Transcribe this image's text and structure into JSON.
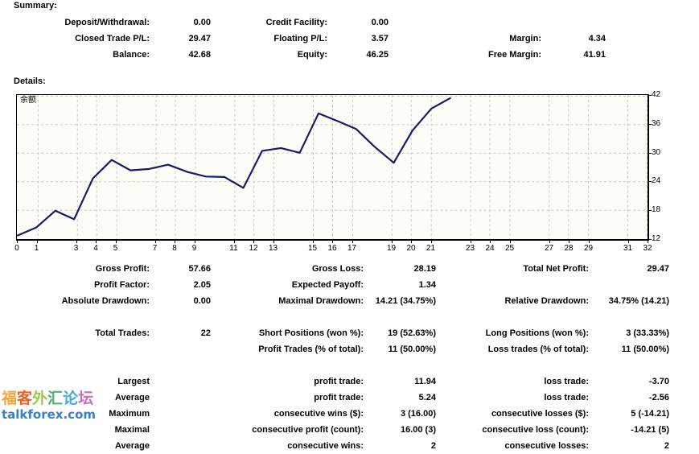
{
  "summary": {
    "title": "Summary:",
    "rows": [
      {
        "l1": "Deposit/Withdrawal:",
        "v1": "0.00",
        "l2": "Credit Facility:",
        "v2": "0.00",
        "l3": "",
        "v3": ""
      },
      {
        "l1": "Closed Trade P/L:",
        "v1": "29.47",
        "l2": "Floating P/L:",
        "v2": "3.57",
        "l3": "Margin:",
        "v3": "4.34"
      },
      {
        "l1": "Balance:",
        "v1": "42.68",
        "l2": "Equity:",
        "v2": "46.25",
        "l3": "Free Margin:",
        "v3": "41.91"
      }
    ]
  },
  "details": {
    "title": "Details:"
  },
  "stats": {
    "rows": [
      {
        "l1": "Gross Profit:",
        "v1": "57.66",
        "l2": "Gross Loss:",
        "v2": "28.19",
        "l3": "Total Net Profit:",
        "v3": "29.47"
      },
      {
        "l1": "Profit Factor:",
        "v1": "2.05",
        "l2": "Expected Payoff:",
        "v2": "1.34",
        "l3": "",
        "v3": ""
      },
      {
        "l1": "Absolute Drawdown:",
        "v1": "0.00",
        "l2": "Maximal Drawdown:",
        "v2": "14.21 (34.75%)",
        "l3": "Relative Drawdown:",
        "v3": "34.75% (14.21)"
      },
      {
        "l1": "",
        "v1": "",
        "l2": "",
        "v2": "",
        "l3": "",
        "v3": ""
      },
      {
        "l1": "Total Trades:",
        "v1": "22",
        "l2": "Short Positions (won %):",
        "v2": "19 (52.63%)",
        "l3": "Long Positions (won %):",
        "v3": "3 (33.33%)"
      },
      {
        "l1": "",
        "v1": "",
        "l2": "Profit Trades (% of total):",
        "v2": "11 (50.00%)",
        "l3": "Loss trades (% of total):",
        "v3": "11 (50.00%)"
      },
      {
        "l1": "",
        "v1": "",
        "l2": "",
        "v2": "",
        "l3": "",
        "v3": ""
      },
      {
        "l1": "Largest",
        "v1": "",
        "l2": "profit trade:",
        "v2": "11.94",
        "l3": "loss trade:",
        "v3": "-3.70"
      },
      {
        "l1": "Average",
        "v1": "",
        "l2": "profit trade:",
        "v2": "5.24",
        "l3": "loss trade:",
        "v3": "-2.56"
      },
      {
        "l1": "Maximum",
        "v1": "",
        "l2": "consecutive wins ($):",
        "v2": "3 (16.00)",
        "l3": "consecutive losses ($):",
        "v3": "5 (-14.21)"
      },
      {
        "l1": "Maximal",
        "v1": "",
        "l2": "consecutive profit (count):",
        "v2": "16.00 (3)",
        "l3": "consecutive loss (count):",
        "v3": "-14.21 (5)"
      },
      {
        "l1": "Average",
        "v1": "",
        "l2": "consecutive wins:",
        "v2": "2",
        "l3": "consecutive losses:",
        "v3": "2"
      }
    ]
  },
  "watermark": {
    "cn_chars": [
      "福",
      "客",
      "外",
      "汇",
      "论",
      "坛"
    ],
    "url": "talkforex.com"
  },
  "chart_data": {
    "type": "line",
    "title": "",
    "series_label": "余额",
    "xlabel": "",
    "ylabel": "",
    "grid": true,
    "legend": "inside-top-left",
    "xlim": [
      0,
      32
    ],
    "ylim": [
      12,
      42
    ],
    "yticks": [
      12,
      18,
      24,
      30,
      36,
      42
    ],
    "xticks": [
      0,
      1,
      3,
      4,
      5,
      7,
      8,
      9,
      11,
      12,
      13,
      15,
      16,
      17,
      19,
      20,
      21,
      23,
      24,
      25,
      27,
      28,
      29,
      31,
      32
    ],
    "line_color": "#1a1a66",
    "x": [
      0,
      1,
      2,
      3,
      4,
      5,
      6,
      7,
      8,
      9,
      10,
      11,
      12,
      13,
      14,
      15,
      16,
      17,
      18,
      19,
      20,
      21,
      22
    ],
    "series": [
      {
        "name": "余额",
        "values": [
          12.6,
          14.3,
          17.8,
          16.0,
          24.6,
          28.5,
          26.3,
          26.6,
          27.5,
          26.0,
          25.0,
          24.9,
          22.6,
          30.4,
          31.0,
          30.0,
          38.3,
          36.7,
          35.0,
          31.2,
          27.9,
          34.7,
          39.3,
          41.5
        ]
      }
    ]
  }
}
